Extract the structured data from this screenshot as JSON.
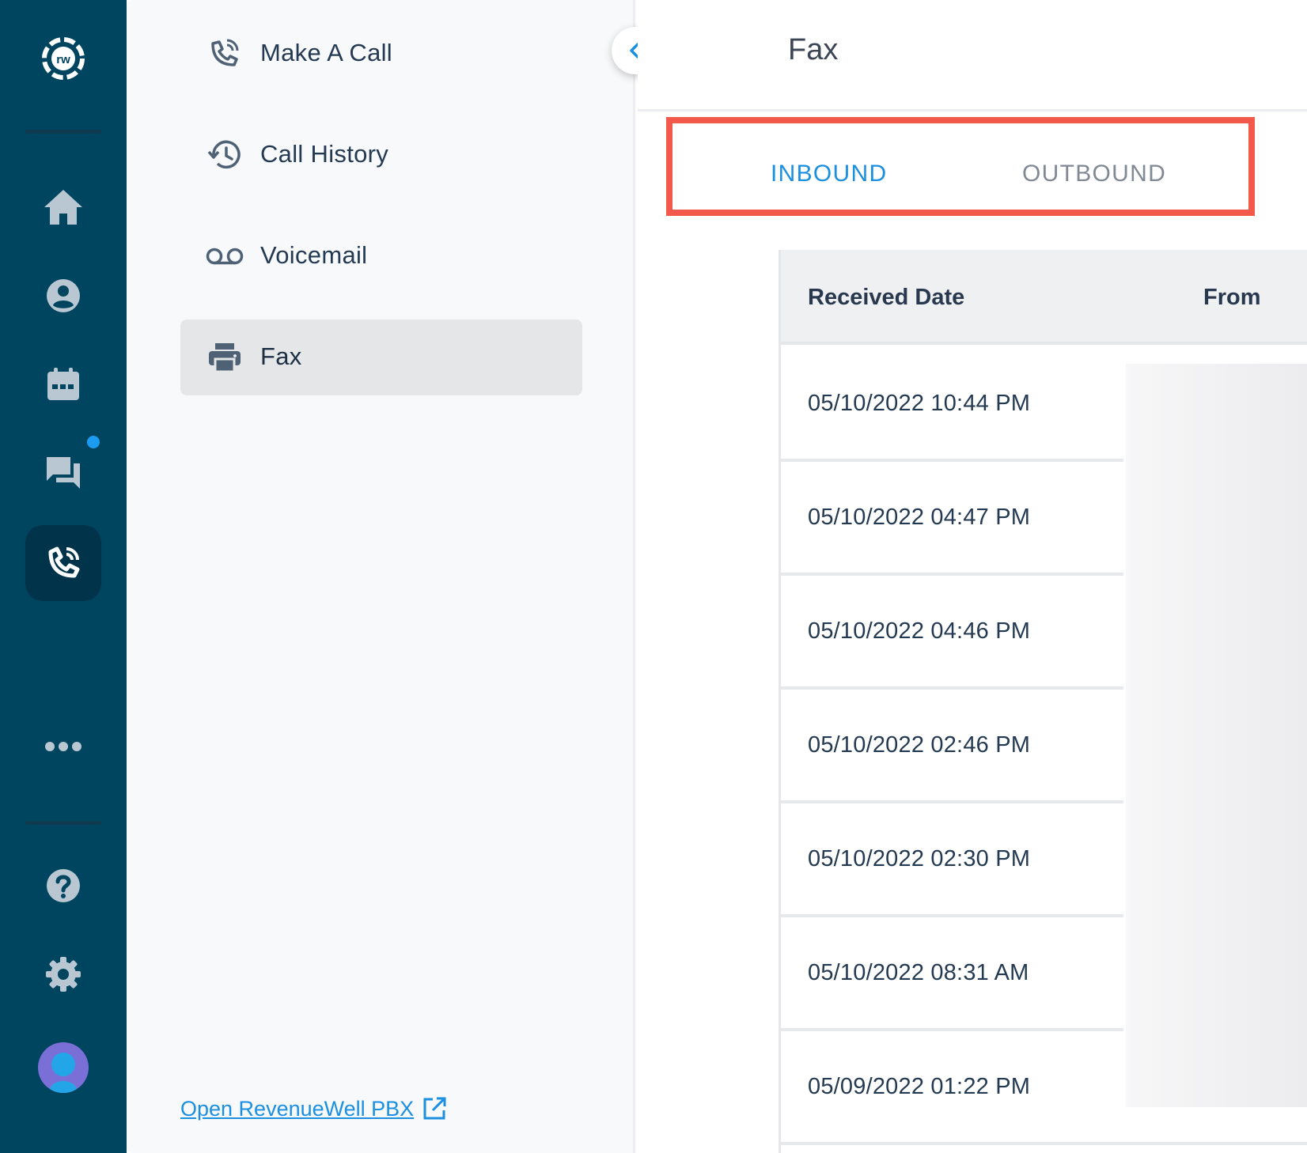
{
  "app": {
    "logo_text": "rw"
  },
  "rail": {
    "items": [
      {
        "icon": "home-icon"
      },
      {
        "icon": "user-icon"
      },
      {
        "icon": "calendar-icon"
      },
      {
        "icon": "chat-icon",
        "has_notification": true
      },
      {
        "icon": "phone-icon",
        "active": true
      },
      {
        "icon": "more-icon"
      },
      {
        "icon": "help-icon"
      },
      {
        "icon": "settings-icon"
      }
    ],
    "notification_color": "#1b9cf1"
  },
  "nav": {
    "items": [
      {
        "label": "Make A Call",
        "icon": "phone-call-icon"
      },
      {
        "label": "Call History",
        "icon": "history-icon"
      },
      {
        "label": "Voicemail",
        "icon": "voicemail-icon"
      },
      {
        "label": "Fax",
        "icon": "printer-icon",
        "selected": true
      }
    ],
    "pbx_link": "Open RevenueWell PBX "
  },
  "main": {
    "title": "Fax",
    "tabs": [
      {
        "label": "INBOUND",
        "active": true
      },
      {
        "label": "OUTBOUND",
        "active": false
      }
    ],
    "table": {
      "columns": [
        "Received Date",
        "From"
      ],
      "rows": [
        {
          "received_date": "05/10/2022 10:44 PM"
        },
        {
          "received_date": "05/10/2022 04:47 PM"
        },
        {
          "received_date": "05/10/2022 04:46 PM"
        },
        {
          "received_date": "05/10/2022 02:46 PM"
        },
        {
          "received_date": "05/10/2022 02:30 PM"
        },
        {
          "received_date": "05/10/2022 08:31 AM"
        },
        {
          "received_date": "05/09/2022 01:22 PM"
        }
      ]
    }
  },
  "colors": {
    "rail": "#004560",
    "accent": "#1b8fe0",
    "highlight_box": "#f2594b"
  }
}
